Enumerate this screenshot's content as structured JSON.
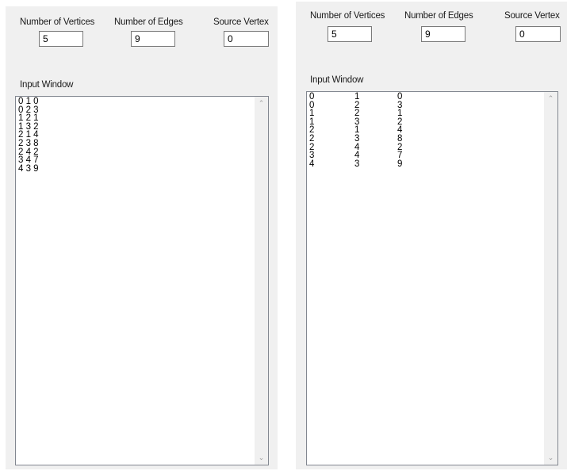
{
  "left_form": {
    "vertices_label": "Number of Vertices",
    "vertices_value": "5",
    "edges_label": "Number of Edges",
    "edges_value": "9",
    "source_label": "Source Vertex",
    "source_value": "0",
    "input_label": "Input Window",
    "input_lines": [
      "0 1 0",
      "0 2 3",
      "1 2 1",
      "1 3 2",
      "2 1 4",
      "2 3 8",
      "2 4 2",
      "3 4 7",
      "4 3 9"
    ]
  },
  "right_form": {
    "vertices_label": "Number of Vertices",
    "vertices_value": "5",
    "edges_label": "Number of Edges",
    "edges_value": "9",
    "source_label": "Source Vertex",
    "source_value": "0",
    "input_label": "Input Window",
    "rows": [
      [
        "0",
        "1",
        "0"
      ],
      [
        "0",
        "2",
        "3"
      ],
      [
        "1",
        "2",
        "1"
      ],
      [
        "1",
        "3",
        "2"
      ],
      [
        "2",
        "1",
        "4"
      ],
      [
        "2",
        "3",
        "8"
      ],
      [
        "2",
        "4",
        "2"
      ],
      [
        "3",
        "4",
        "7"
      ],
      [
        "4",
        "3",
        "9"
      ]
    ]
  },
  "icons": {
    "scroll_up": "chevron-up-icon",
    "scroll_down": "chevron-down-icon"
  }
}
